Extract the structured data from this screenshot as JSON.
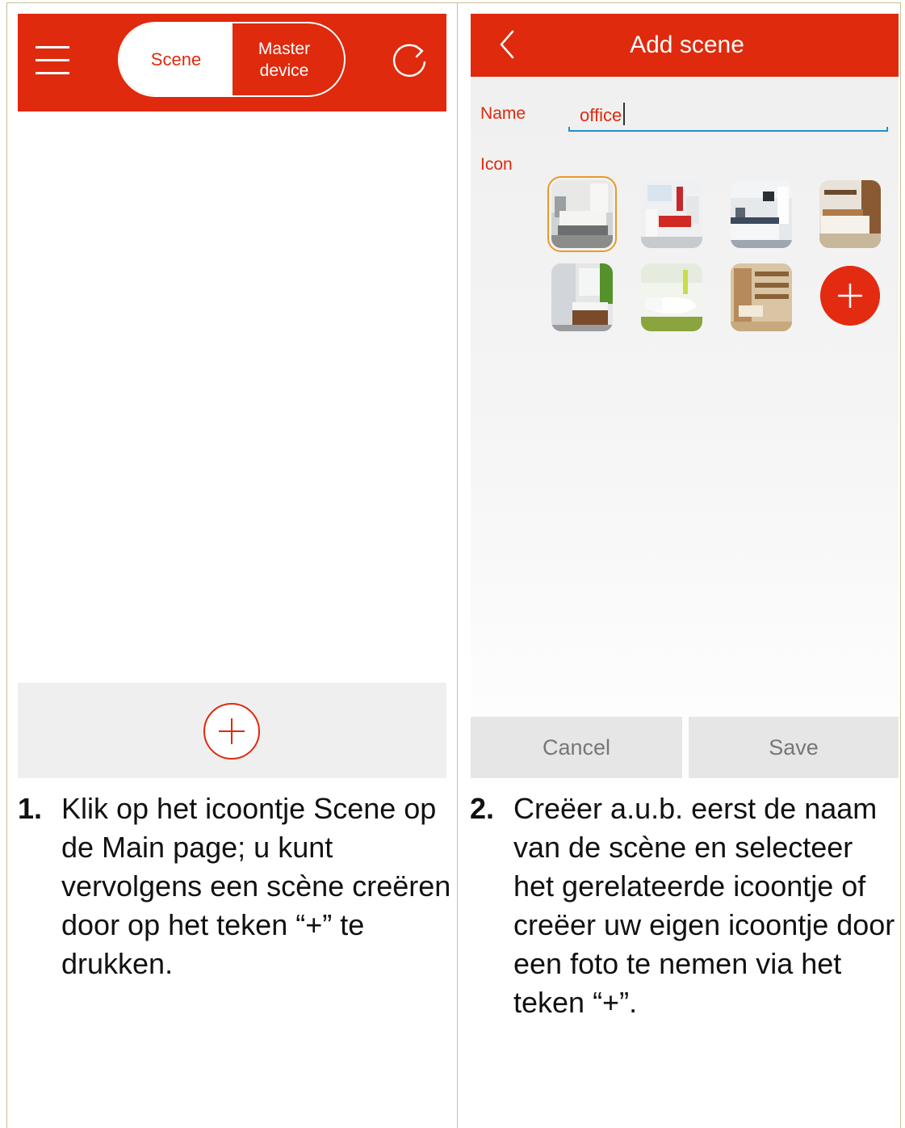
{
  "left_screen": {
    "tabs": {
      "scene": "Scene",
      "master_device": "Master device"
    }
  },
  "right_screen": {
    "title": "Add scene",
    "name_label": "Name",
    "name_value": "office",
    "icon_label": "Icon",
    "cancel_label": "Cancel",
    "save_label": "Save"
  },
  "captions": [
    {
      "number": "1.",
      "text": "Klik op het icoontje Scene op de Main page; u kunt vervolgens een scène creëren door op het teken “+” te drukken."
    },
    {
      "number": "2.",
      "text": "Creëer a.u.b. eerst de naam van de scène en selecteer het gerelateerde icoontje of creëer uw eigen icoontje door een foto te nemen via het teken “+”."
    }
  ],
  "colors": {
    "accent": "#df2a0d",
    "input_underline": "#1f8fcf",
    "selected_outline": "#e79a2a",
    "frame": "#c9bf94"
  }
}
